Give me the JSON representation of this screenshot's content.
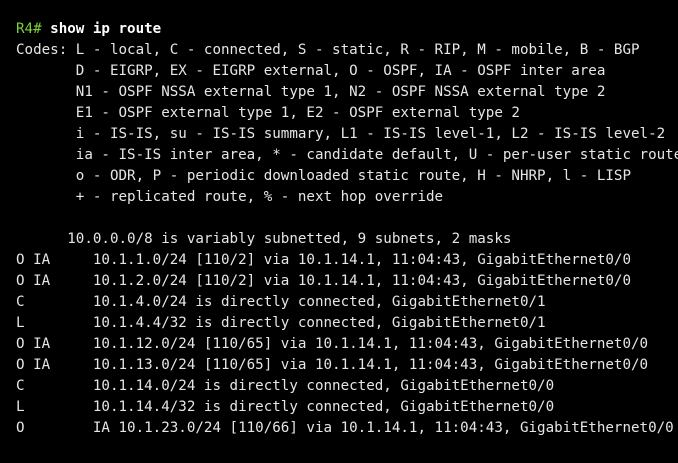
{
  "terminal": {
    "prompt": "R4#",
    "command": "show ip route",
    "colors": {
      "background": "#000000",
      "text": "#e6e6e6",
      "prompt": "#7dd13a",
      "command": "#ffffff"
    },
    "codes": [
      "Codes: L - local, C - connected, S - static, R - RIP, M - mobile, B - BGP",
      "       D - EIGRP, EX - EIGRP external, O - OSPF, IA - OSPF inter area",
      "       N1 - OSPF NSSA external type 1, N2 - OSPF NSSA external type 2",
      "       E1 - OSPF external type 1, E2 - OSPF external type 2",
      "       i - IS-IS, su - IS-IS summary, L1 - IS-IS level-1, L2 - IS-IS level-2",
      "       ia - IS-IS inter area, * - candidate default, U - per-user static route",
      "       o - ODR, P - periodic downloaded static route, H - NHRP, l - LISP",
      "       + - replicated route, % - next hop override"
    ],
    "summary": "      10.0.0.0/8 is variably subnetted, 9 subnets, 2 masks",
    "routes": [
      "O IA     10.1.1.0/24 [110/2] via 10.1.14.1, 11:04:43, GigabitEthernet0/0",
      "O IA     10.1.2.0/24 [110/2] via 10.1.14.1, 11:04:43, GigabitEthernet0/0",
      "C        10.1.4.0/24 is directly connected, GigabitEthernet0/1",
      "L        10.1.4.4/32 is directly connected, GigabitEthernet0/1",
      "O IA     10.1.12.0/24 [110/65] via 10.1.14.1, 11:04:43, GigabitEthernet0/0",
      "O IA     10.1.13.0/24 [110/65] via 10.1.14.1, 11:04:43, GigabitEthernet0/0",
      "C        10.1.14.0/24 is directly connected, GigabitEthernet0/0",
      "L        10.1.14.4/32 is directly connected, GigabitEthernet0/0",
      "O        IA 10.1.23.0/24 [110/66] via 10.1.14.1, 11:04:43, GigabitEthernet0/0"
    ]
  }
}
